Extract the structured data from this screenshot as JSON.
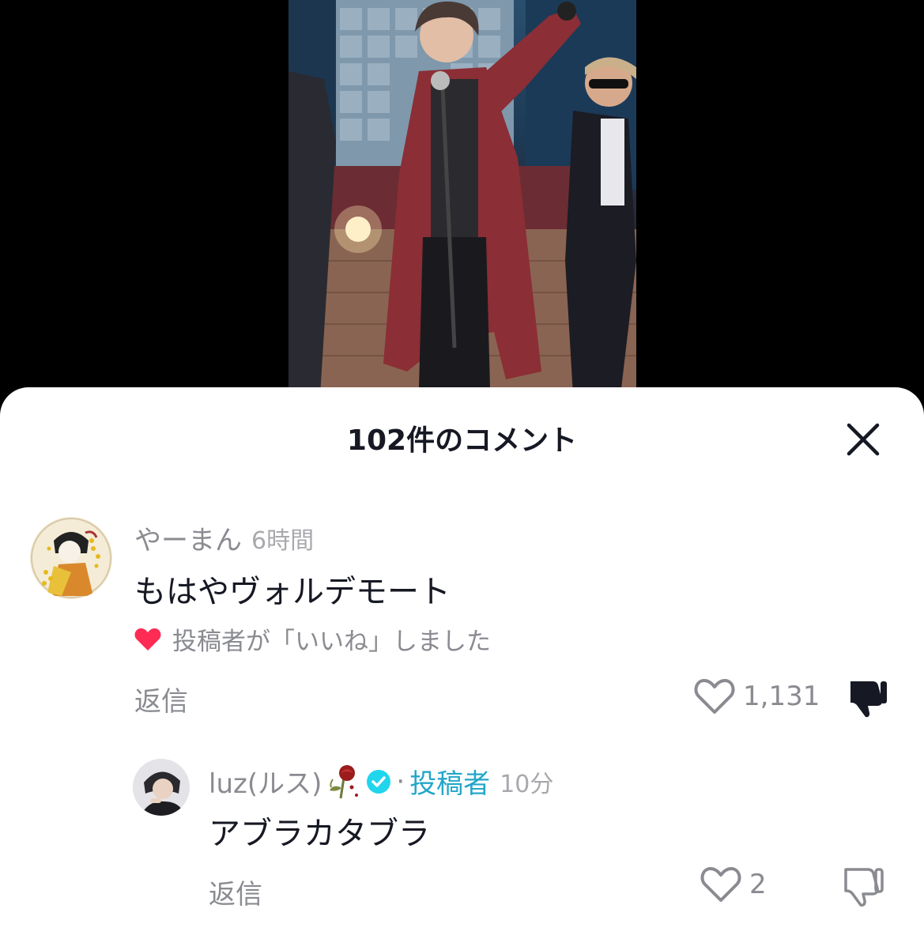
{
  "sheet": {
    "title": "102件のコメント"
  },
  "comments": [
    {
      "username": "やーまん",
      "time": "6時間",
      "text": "もはやヴォルデモート",
      "liked_by_creator": "投稿者が「いいね」しました",
      "reply_label": "返信",
      "like_count": "1,131",
      "disliked": true
    }
  ],
  "replies": [
    {
      "username": "luz(ルス)",
      "separator": "·",
      "creator_label": "投稿者",
      "time": "10分",
      "text": "アブラカタブラ",
      "reply_label": "返信",
      "like_count": "2",
      "disliked": false
    }
  ],
  "colors": {
    "heart": "#fe2c55",
    "creator_badge": "#23a6c9",
    "verified": "#20d5ec"
  },
  "icons": [
    "close-icon",
    "heart-filled-icon",
    "heart-outline-icon",
    "thumbs-down-icon",
    "verified-icon",
    "rose-emoji"
  ]
}
